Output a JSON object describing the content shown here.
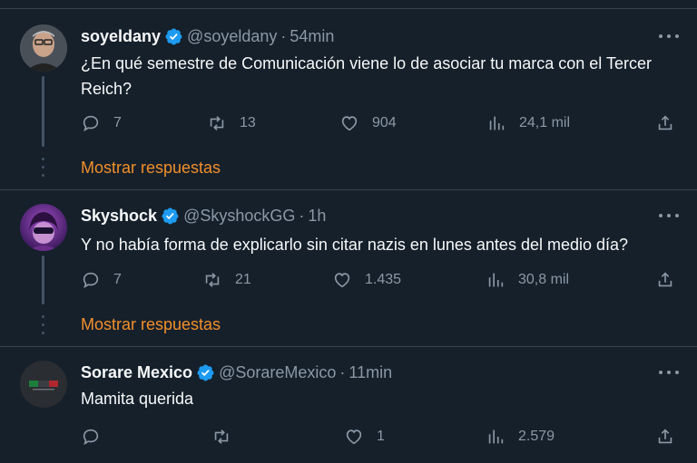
{
  "colors": {
    "background": "#15202b",
    "text": "#f7f9f9",
    "muted": "#8b98a5",
    "verified": "#1d9bf0",
    "link": "#f38f2a",
    "divider": "#38444d"
  },
  "tweets": [
    {
      "name": "soyeldany",
      "handle": "@soyeldany",
      "separator": "·",
      "time": "54min",
      "text": "¿En qué semestre de Comunicación viene lo de asociar tu marca con el Tercer Reich?",
      "replies": "7",
      "retweets": "13",
      "likes": "904",
      "views": "24,1 mil",
      "show_replies": "Mostrar respuestas"
    },
    {
      "name": "Skyshock",
      "handle": "@SkyshockGG",
      "separator": "·",
      "time": "1h",
      "text": "Y no había forma de explicarlo sin citar nazis en lunes antes del medio día?",
      "replies": "7",
      "retweets": "21",
      "likes": "1.435",
      "views": "30,8 mil",
      "show_replies": "Mostrar respuestas"
    },
    {
      "name": "Sorare Mexico",
      "handle": "@SorareMexico",
      "separator": "·",
      "time": "11min",
      "text": "Mamita querida",
      "replies": "",
      "retweets": "",
      "likes": "1",
      "views": "2.579"
    }
  ]
}
